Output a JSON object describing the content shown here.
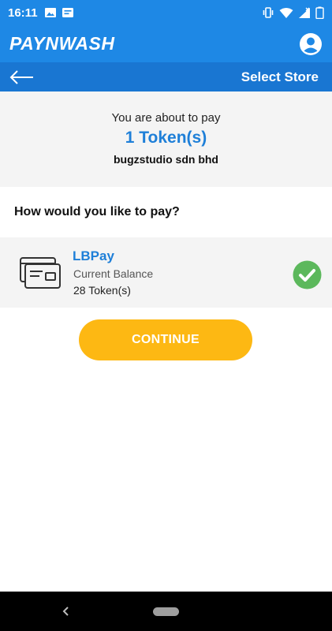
{
  "status_bar": {
    "time": "16:11",
    "left_icons": [
      "image-icon",
      "message-icon"
    ],
    "right_icons": [
      "vibrate-icon",
      "wifi-icon",
      "signal-icon",
      "battery-icon"
    ]
  },
  "app_bar": {
    "title": "PAYNWASH",
    "account_icon": "account-circle-icon"
  },
  "nav_bar": {
    "back_icon": "arrow-left-icon",
    "title": "Select Store"
  },
  "summary": {
    "label": "You are about to pay",
    "amount": "1 Token(s)",
    "merchant": "bugzstudio sdn bhd"
  },
  "payment": {
    "question": "How would you like to pay?",
    "options": [
      {
        "icon": "credit-card-icon",
        "name": "LBPay",
        "balance_label": "Current Balance",
        "balance_value": "28 Token(s)",
        "selected": true
      }
    ]
  },
  "continue_label": "CONTINUE",
  "colors": {
    "primary": "#1e88e5",
    "primary_dark": "#1976d2",
    "accent_text": "#1e7fd8",
    "button": "#fdb813",
    "check": "#5cb85c"
  },
  "android_nav": {
    "back_icon": "nav-back-icon",
    "home_icon": "nav-home-pill"
  }
}
